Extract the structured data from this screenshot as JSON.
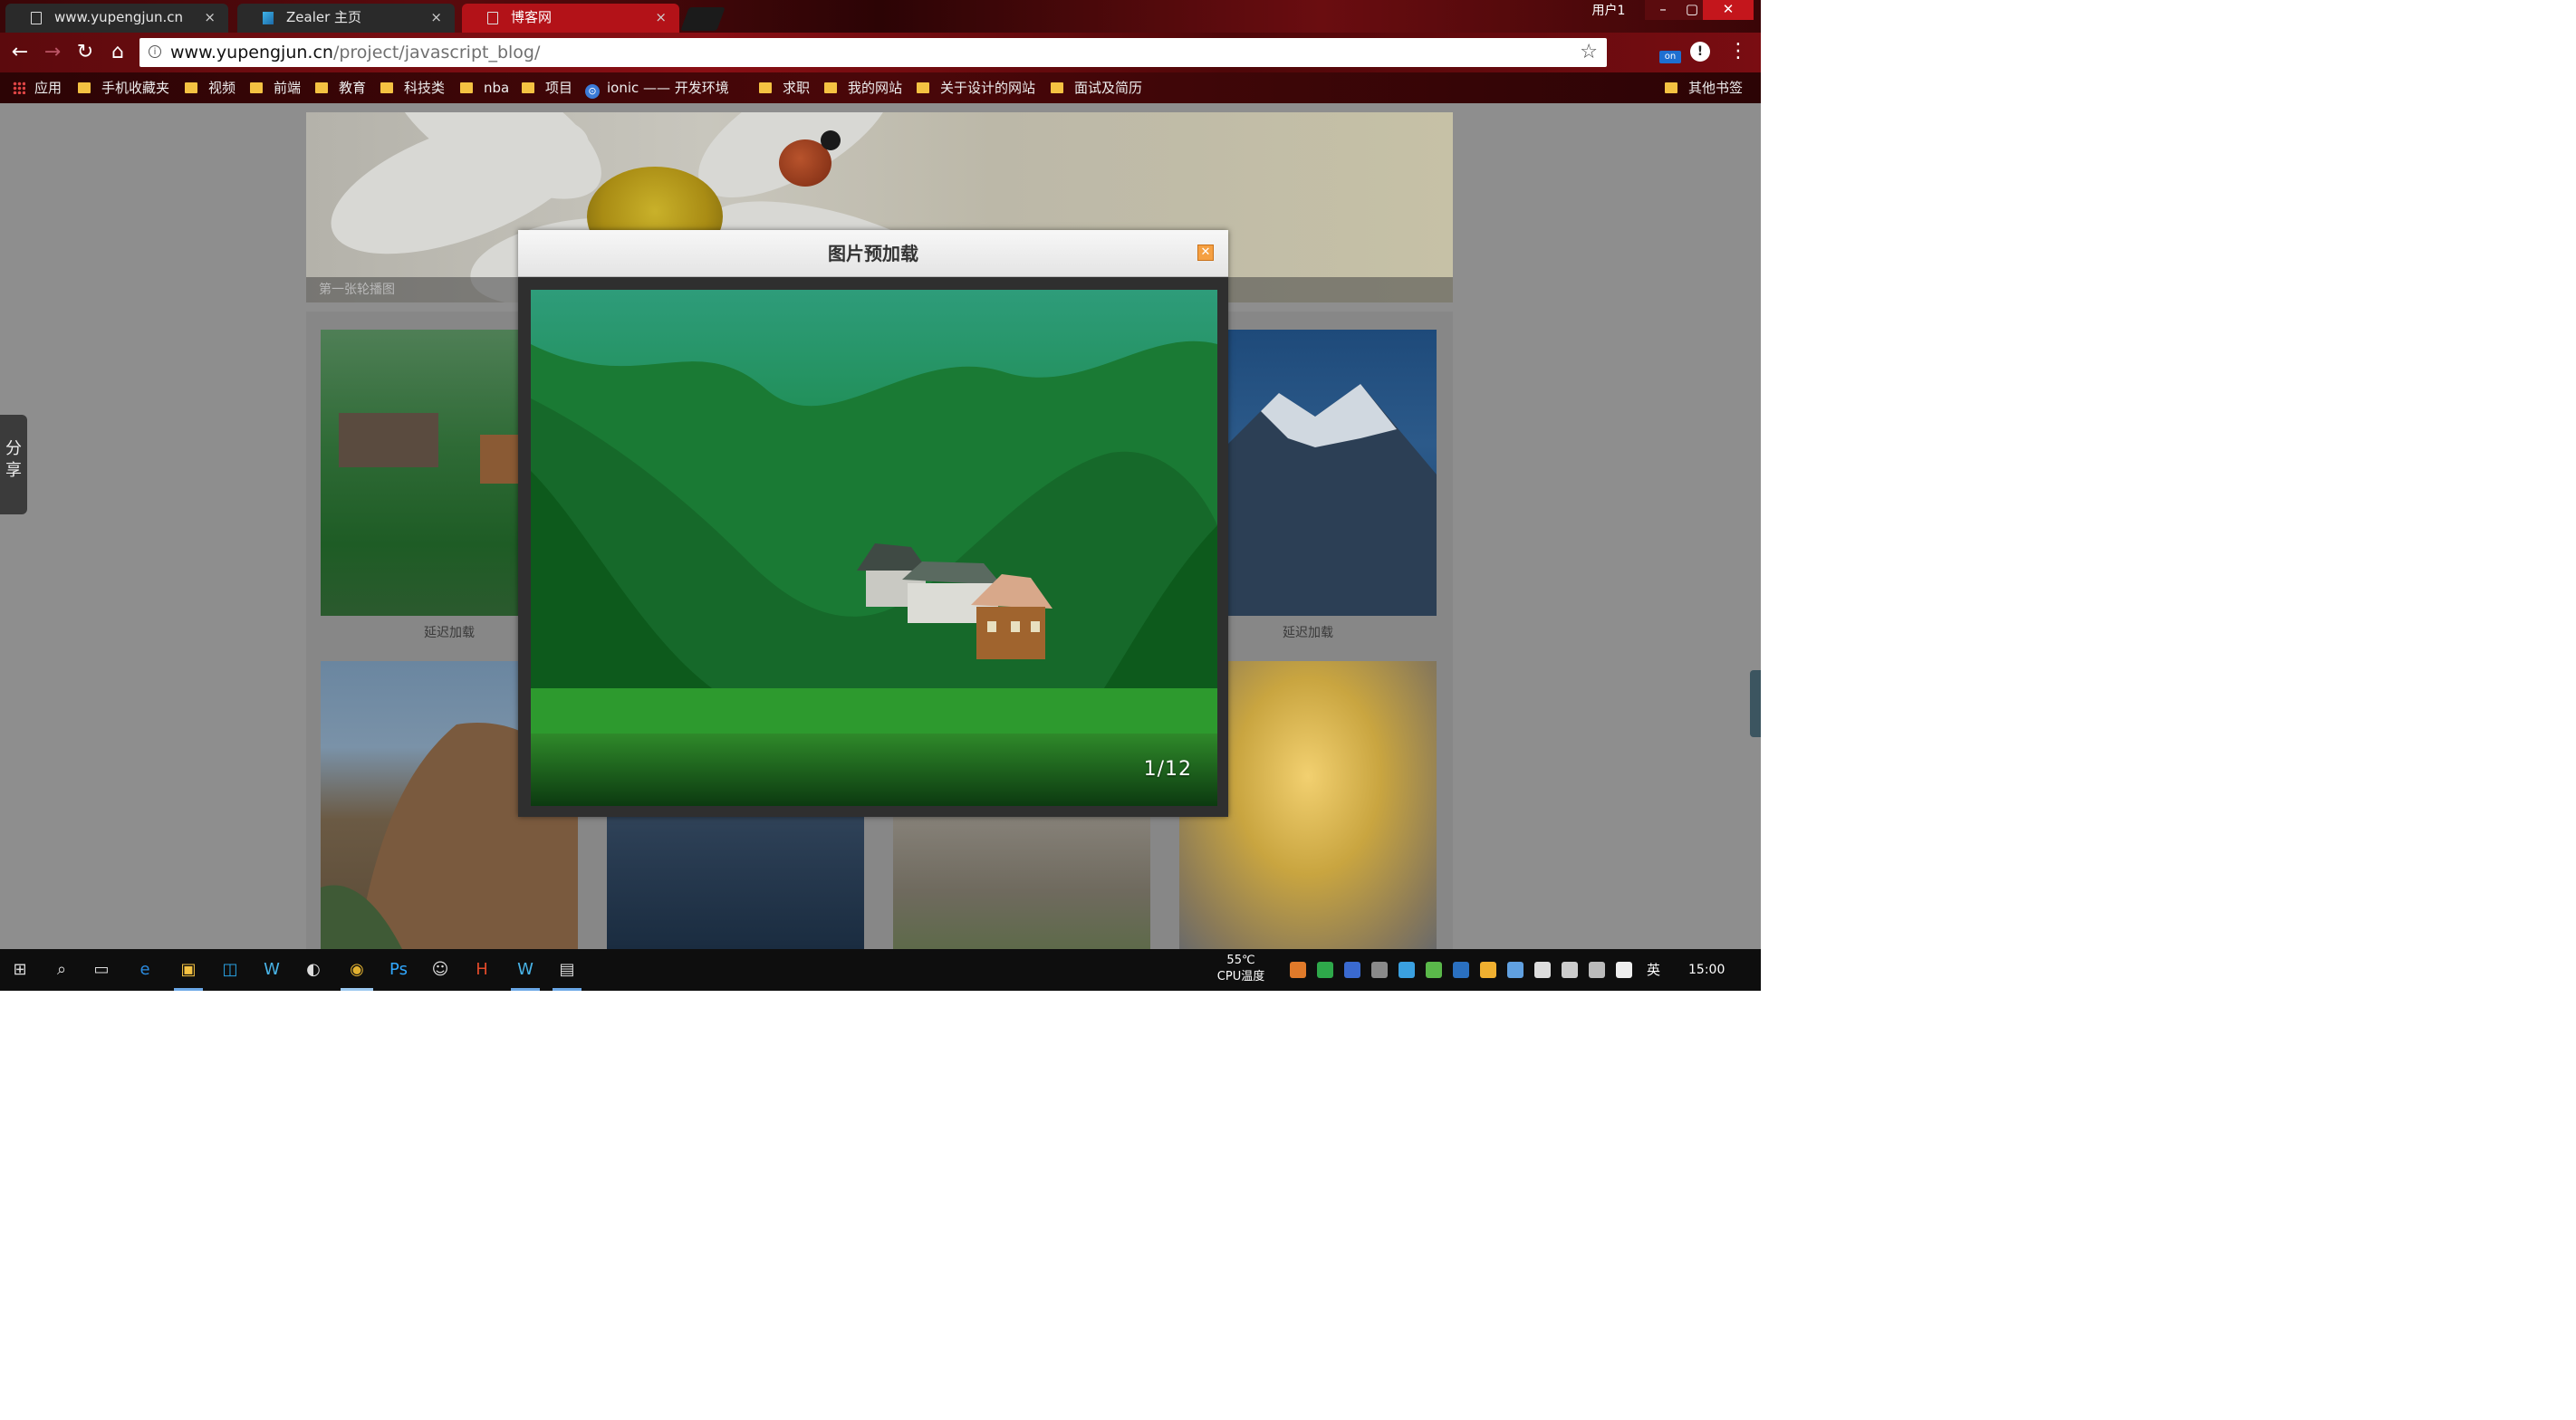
{
  "browser": {
    "tabs": [
      {
        "title": "www.yupengjun.cn",
        "active": false
      },
      {
        "title": "Zealer 主页",
        "active": false
      },
      {
        "title": "博客网",
        "active": true
      }
    ],
    "tab_close_glyph": "×",
    "profile": "用户1",
    "window_controls": {
      "minimize": "–",
      "restore": "▢",
      "close": "✕"
    },
    "address": {
      "host": "www.yupengjun.cn",
      "path": "/project/javascript_blog/"
    },
    "ext_badge": "on"
  },
  "bookmarks": {
    "apps": "应用",
    "items": [
      "手机收藏夹",
      "视频",
      "前端",
      "教育",
      "科技类",
      "nba",
      "项目",
      "ionic —— 开发环境",
      "求职",
      "我的网站",
      "关于设计的网站",
      "面试及简历"
    ],
    "other": "其他书签"
  },
  "page": {
    "banner_caption": "第一张轮播图",
    "share_label": "分享",
    "thumb_caption": "延迟加载"
  },
  "modal": {
    "title": "图片预加载",
    "close_glyph": "✕",
    "counter": "1/12"
  },
  "taskbar": {
    "cpu_temp": "55℃",
    "cpu_label": "CPU温度",
    "ime": "英",
    "clock": "15:00"
  },
  "colors": {
    "tab_active": "#b31218",
    "modal_close": "#f5a042",
    "overlay": "#8f8f8f"
  }
}
